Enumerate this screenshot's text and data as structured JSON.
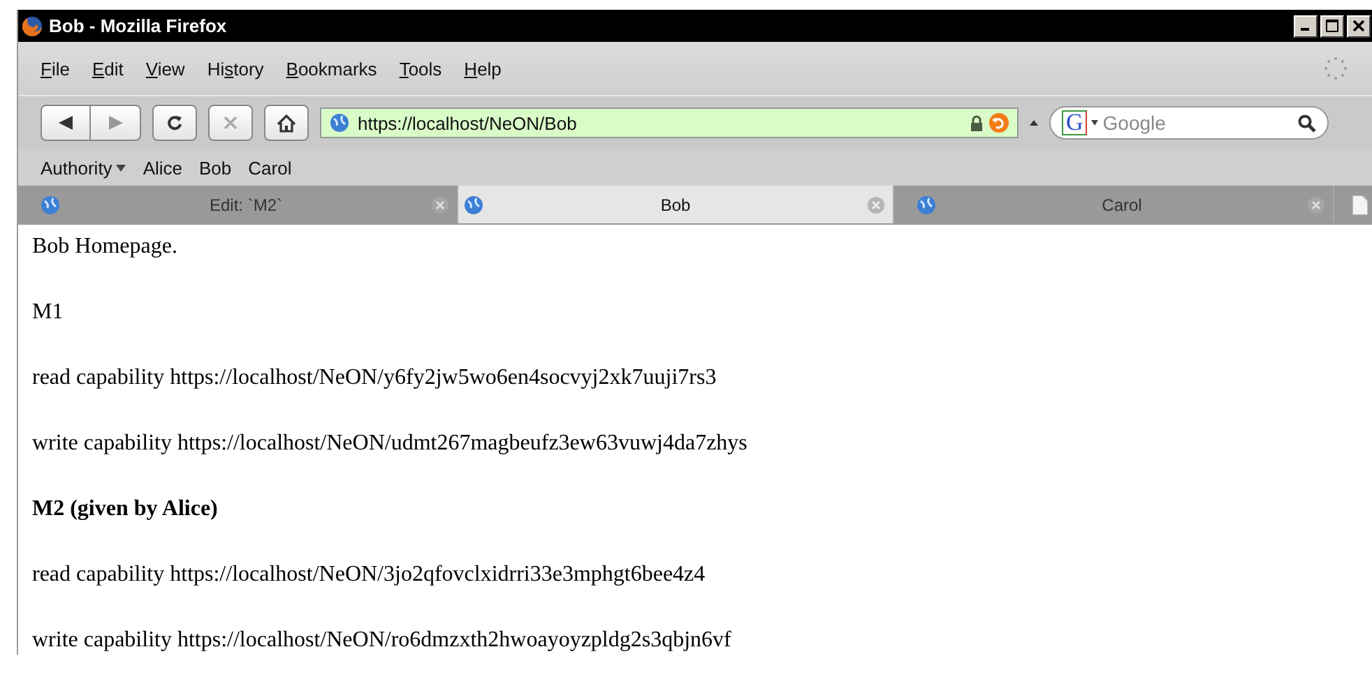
{
  "window": {
    "title": "Bob - Mozilla Firefox"
  },
  "menu": [
    {
      "key": "F",
      "rest": "ile"
    },
    {
      "key": "E",
      "rest": "dit"
    },
    {
      "key": "V",
      "rest": "iew"
    },
    {
      "pre": "Hi",
      "key": "s",
      "rest": "tory"
    },
    {
      "key": "B",
      "rest": "ookmarks"
    },
    {
      "key": "T",
      "rest": "ools"
    },
    {
      "key": "H",
      "rest": "elp"
    }
  ],
  "address": {
    "value": "https://localhost/NeON/Bob",
    "secure": true
  },
  "search": {
    "engine_logo": "G",
    "placeholder": "Google"
  },
  "bookmarks": [
    {
      "label": "Authority",
      "kind": "folder"
    },
    {
      "label": "Alice",
      "kind": "link"
    },
    {
      "label": "Bob",
      "kind": "link"
    },
    {
      "label": "Carol",
      "kind": "link"
    }
  ],
  "tabs": [
    {
      "label": "Edit: `M2`",
      "selected": false
    },
    {
      "label": "Bob",
      "selected": true
    },
    {
      "label": "Carol",
      "selected": false
    }
  ],
  "content": [
    {
      "kind": "text",
      "text": "Bob Homepage."
    },
    {
      "kind": "text",
      "text": "M1"
    },
    {
      "kind": "text",
      "text": "read capability https://localhost/NeON/y6fy2jw5wo6en4socvyj2xk7uuji7rs3"
    },
    {
      "kind": "text",
      "text": "write capability https://localhost/NeON/udmt267magbeufz3ew63vuwj4da7zhys"
    },
    {
      "kind": "heading",
      "text": "M2 (given by Alice)"
    },
    {
      "kind": "text",
      "text": "read capability https://localhost/NeON/3jo2qfovclxidrri33e3mphgt6bee4z4"
    },
    {
      "kind": "text",
      "text": "write capability https://localhost/NeON/ro6dmzxth2hwoayoyzpldg2s3qbjn6vf"
    }
  ]
}
